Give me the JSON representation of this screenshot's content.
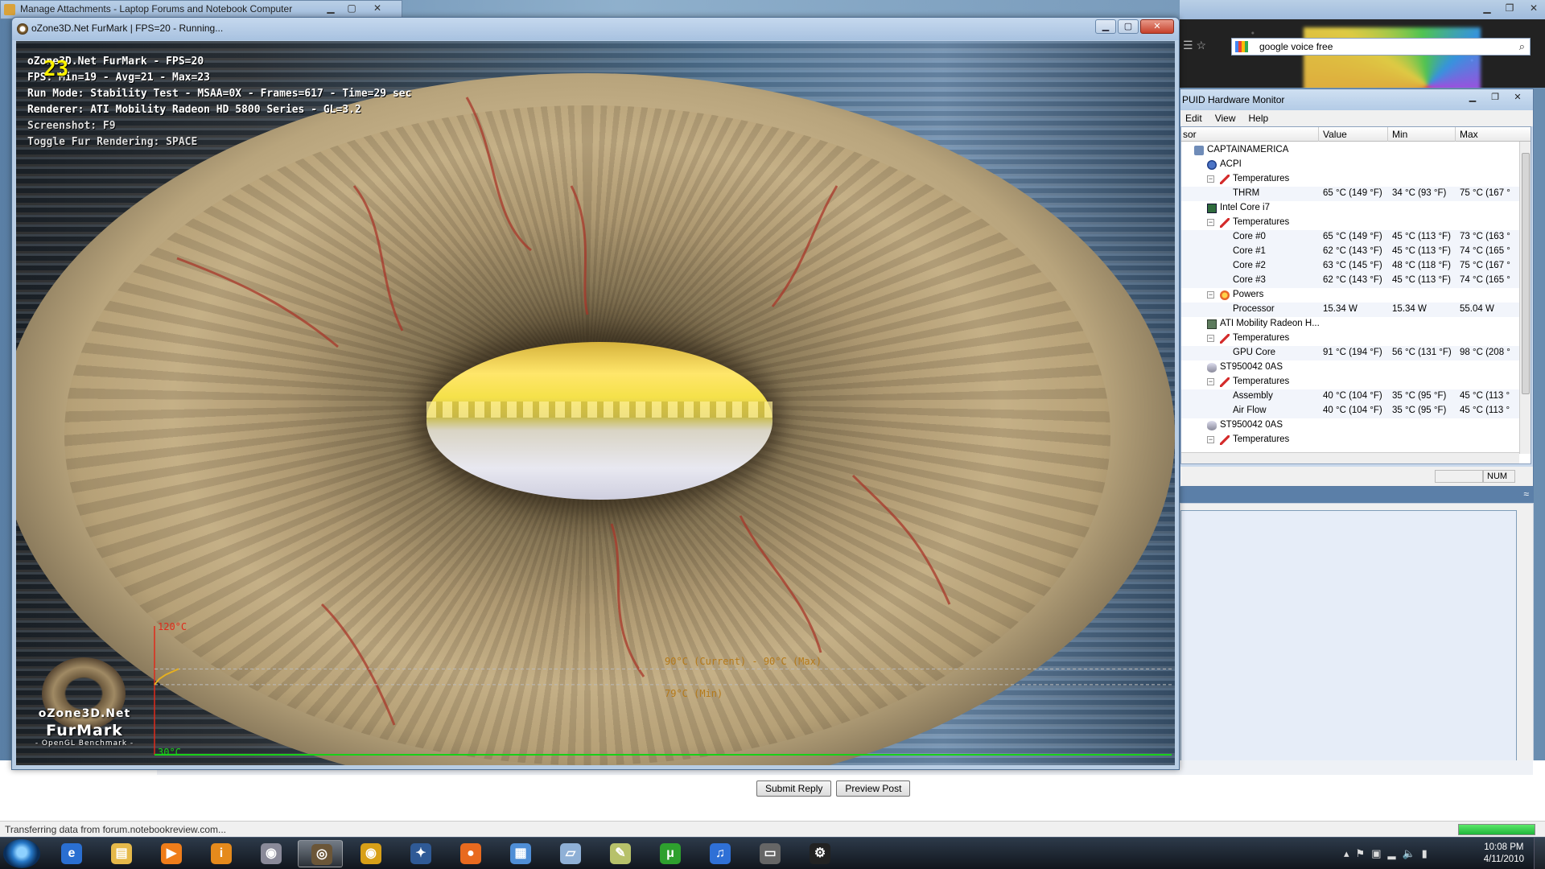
{
  "background_window": {
    "title": "Manage Attachments - Laptop Forums and Notebook Computer",
    "search_value": "google voice free",
    "status_text": "Transferring data from forum.notebookreview.com...",
    "submit_label": "Submit Reply",
    "preview_label": "Preview Post",
    "status_progress_fraction": 1.0
  },
  "furmark": {
    "window_title": "oZone3D.Net FurMark | FPS=20 - Running...",
    "fps_overlay": "23",
    "hud_lines": [
      "oZone3D.Net FurMark - FPS=20",
      "FPS: Min=19 - Avg=21 - Max=23",
      "Run Mode: Stability Test - MSAA=0X - Frames=617 - Time=29 sec",
      "Renderer: ATI Mobility Radeon HD 5800 Series - GL=3.2",
      "Screenshot: F9",
      "Toggle Fur Rendering: SPACE"
    ],
    "logo": {
      "line1": "oZone3D.Net",
      "line2": "FurMark",
      "line3": "- OpenGL Benchmark -"
    },
    "graph": {
      "top_label": "120°C",
      "bottom_label": "30°C",
      "current_max_label": "90°C (Current) - 90°C (Max)",
      "min_label": "79°C (Min)",
      "y_max": 120,
      "y_min": 30,
      "current": 90,
      "max": 90,
      "min": 79,
      "colors": {
        "axis_top": "#e02a1a",
        "axis_bottom": "#18d018",
        "curve": "#e6b020",
        "label": "#b57a1a"
      }
    }
  },
  "hwmonitor": {
    "title": "PUID Hardware Monitor",
    "menu": [
      "Edit",
      "View",
      "Help"
    ],
    "columns": [
      "sor",
      "Value",
      "Min",
      "Max"
    ],
    "rows": [
      {
        "indent": 0,
        "icon": "pc",
        "expander": "",
        "label": "CAPTAINAMERICA",
        "value": "",
        "min": "",
        "max": ""
      },
      {
        "indent": 1,
        "icon": "acpi",
        "expander": "",
        "label": "ACPI",
        "value": "",
        "min": "",
        "max": ""
      },
      {
        "indent": 2,
        "icon": "therm",
        "expander": "−",
        "label": "Temperatures",
        "value": "",
        "min": "",
        "max": ""
      },
      {
        "indent": 3,
        "icon": "",
        "expander": "",
        "label": "THRM",
        "value": "65 °C  (149 °F)",
        "min": "34 °C  (93 °F)",
        "max": "75 °C  (167 °"
      },
      {
        "indent": 1,
        "icon": "chip",
        "expander": "",
        "label": "Intel Core i7",
        "value": "",
        "min": "",
        "max": ""
      },
      {
        "indent": 2,
        "icon": "therm",
        "expander": "−",
        "label": "Temperatures",
        "value": "",
        "min": "",
        "max": ""
      },
      {
        "indent": 3,
        "icon": "",
        "expander": "",
        "label": "Core #0",
        "value": "65 °C  (149 °F)",
        "min": "45 °C  (113 °F)",
        "max": "73 °C  (163 °"
      },
      {
        "indent": 3,
        "icon": "",
        "expander": "",
        "label": "Core #1",
        "value": "62 °C  (143 °F)",
        "min": "45 °C  (113 °F)",
        "max": "74 °C  (165 °"
      },
      {
        "indent": 3,
        "icon": "",
        "expander": "",
        "label": "Core #2",
        "value": "63 °C  (145 °F)",
        "min": "48 °C  (118 °F)",
        "max": "75 °C  (167 °"
      },
      {
        "indent": 3,
        "icon": "",
        "expander": "",
        "label": "Core #3",
        "value": "62 °C  (143 °F)",
        "min": "45 °C  (113 °F)",
        "max": "74 °C  (165 °"
      },
      {
        "indent": 2,
        "icon": "power",
        "expander": "−",
        "label": "Powers",
        "value": "",
        "min": "",
        "max": ""
      },
      {
        "indent": 3,
        "icon": "",
        "expander": "",
        "label": "Processor",
        "value": "15.34 W",
        "min": "15.34 W",
        "max": "55.04 W"
      },
      {
        "indent": 1,
        "icon": "gpu",
        "expander": "",
        "label": "ATI Mobility Radeon H...",
        "value": "",
        "min": "",
        "max": ""
      },
      {
        "indent": 2,
        "icon": "therm",
        "expander": "−",
        "label": "Temperatures",
        "value": "",
        "min": "",
        "max": ""
      },
      {
        "indent": 3,
        "icon": "",
        "expander": "",
        "label": "GPU Core",
        "value": "91 °C  (194 °F)",
        "min": "56 °C  (131 °F)",
        "max": "98 °C  (208 °"
      },
      {
        "indent": 1,
        "icon": "disk",
        "expander": "",
        "label": "ST950042 0AS",
        "value": "",
        "min": "",
        "max": ""
      },
      {
        "indent": 2,
        "icon": "therm",
        "expander": "−",
        "label": "Temperatures",
        "value": "",
        "min": "",
        "max": ""
      },
      {
        "indent": 3,
        "icon": "",
        "expander": "",
        "label": "Assembly",
        "value": "40 °C  (104 °F)",
        "min": "35 °C  (95 °F)",
        "max": "45 °C  (113 °"
      },
      {
        "indent": 3,
        "icon": "",
        "expander": "",
        "label": "Air Flow",
        "value": "40 °C  (104 °F)",
        "min": "35 °C  (95 °F)",
        "max": "45 °C  (113 °"
      },
      {
        "indent": 1,
        "icon": "disk",
        "expander": "",
        "label": "ST950042 0AS",
        "value": "",
        "min": "",
        "max": ""
      },
      {
        "indent": 2,
        "icon": "therm",
        "expander": "−",
        "label": "Temperatures",
        "value": "",
        "min": "",
        "max": ""
      }
    ],
    "status_num": "NUM"
  },
  "taskbar": {
    "items": [
      {
        "name": "internet-explorer",
        "glyph": "e",
        "color": "#2a6fd1",
        "active": false
      },
      {
        "name": "windows-explorer",
        "glyph": "▤",
        "color": "#e6b94a",
        "active": false
      },
      {
        "name": "media-player",
        "glyph": "▶",
        "color": "#ef7d1a",
        "active": false
      },
      {
        "name": "info-app",
        "glyph": "i",
        "color": "#e58a1c",
        "active": false
      },
      {
        "name": "dvd-app",
        "glyph": "◉",
        "color": "#8a8a99",
        "active": false
      },
      {
        "name": "furmark",
        "glyph": "◎",
        "color": "#6b5638",
        "active": true
      },
      {
        "name": "eye-app",
        "glyph": "◉",
        "color": "#d8a018",
        "active": false
      },
      {
        "name": "cpuid-app",
        "glyph": "✦",
        "color": "#2f5a96",
        "active": false
      },
      {
        "name": "firefox",
        "glyph": "●",
        "color": "#e86a1f",
        "active": false
      },
      {
        "name": "control-panel",
        "glyph": "▦",
        "color": "#4f8ed6",
        "active": false
      },
      {
        "name": "notes-app",
        "glyph": "▱",
        "color": "#8fb0d6",
        "active": false
      },
      {
        "name": "ticket-app",
        "glyph": "✎",
        "color": "#b7c16a",
        "active": false
      },
      {
        "name": "utorrent",
        "glyph": "μ",
        "color": "#2ea02e",
        "active": false
      },
      {
        "name": "itunes",
        "glyph": "♫",
        "color": "#2f70d6",
        "active": false
      },
      {
        "name": "hwmonitor-app",
        "glyph": "▭",
        "color": "#666",
        "active": false
      },
      {
        "name": "steam",
        "glyph": "⚙",
        "color": "#222",
        "active": false
      }
    ],
    "clock_time": "10:08 PM",
    "clock_date": "4/11/2010"
  }
}
